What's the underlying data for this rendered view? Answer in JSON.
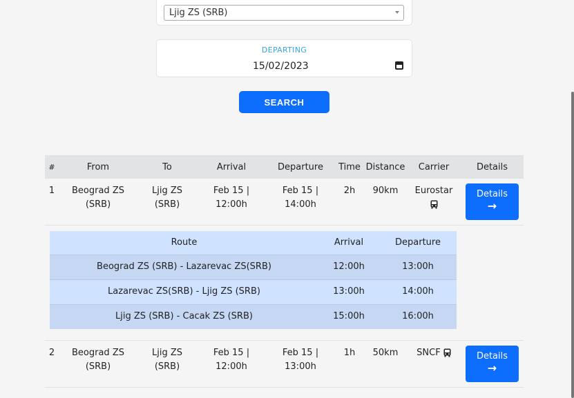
{
  "form": {
    "station_select_value": "Ljig ZS (SRB)",
    "departing_label": "DEPARTING",
    "departing_value": "15/02/2023",
    "search_label": "SEARCH"
  },
  "table": {
    "headers": [
      "#",
      "From",
      "To",
      "Arrival",
      "Departure",
      "Time",
      "Distance",
      "Carrier",
      "Details"
    ],
    "rows": [
      {
        "num": "1",
        "from": "Beograd ZS (SRB)",
        "to": "Ljig ZS (SRB)",
        "arrival": "Feb 15 | 12:00h",
        "departure": "Feb 15 | 14:00h",
        "time": "2h",
        "distance": "90km",
        "carrier": "Eurostar",
        "details_label": "Details",
        "carrier_icon": "bus-icon"
      },
      {
        "num": "2",
        "from": "Beograd ZS (SRB)",
        "to": "Ljig ZS (SRB)",
        "arrival": "Feb 15 | 12:00h",
        "departure": "Feb 15 | 13:00h",
        "time": "1h",
        "distance": "50km",
        "carrier": "SNCF",
        "details_label": "Details",
        "carrier_icon": "bus-icon"
      }
    ]
  },
  "route_table": {
    "headers": [
      "Route",
      "Arrival",
      "Departure"
    ],
    "rows": [
      {
        "route": "Beograd ZS (SRB) - Lazarevac ZS(SRB)",
        "arrival": "12:00h",
        "departure": "13:00h"
      },
      {
        "route": "Lazarevac ZS(SRB) - Ljig ZS (SRB)",
        "arrival": "13:00h",
        "departure": "14:00h"
      },
      {
        "route": "Ljig ZS (SRB) - Cacak ZS (SRB)",
        "arrival": "15:00h",
        "departure": "16:00h"
      }
    ]
  },
  "colors": {
    "primary": "#0d6efd",
    "header_bg": "#e2e3e5",
    "route_bg": "#cfe2ff",
    "route_row_dark": "#c5d7f2",
    "label_blue": "#3aa3e3"
  }
}
